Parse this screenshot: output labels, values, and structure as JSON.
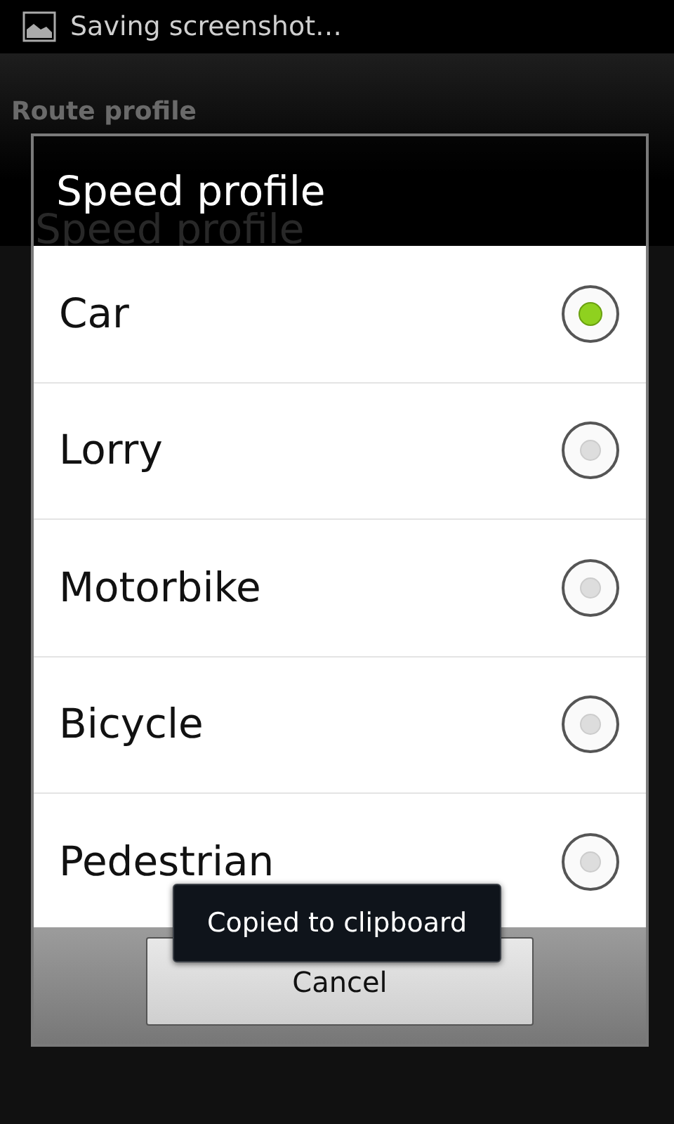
{
  "status_bar": {
    "notification": "Saving screenshot…"
  },
  "action_bar": {
    "title": "Route profile"
  },
  "background": {
    "heading": "Speed profile"
  },
  "dialog": {
    "title": "Speed profile",
    "options": [
      {
        "label": "Car",
        "selected": true
      },
      {
        "label": "Lorry",
        "selected": false
      },
      {
        "label": "Motorbike",
        "selected": false
      },
      {
        "label": "Bicycle",
        "selected": false
      },
      {
        "label": "Pedestrian",
        "selected": false
      }
    ],
    "buttons": [
      "Cancel"
    ]
  },
  "toast": {
    "text": "Copied to clipboard"
  }
}
